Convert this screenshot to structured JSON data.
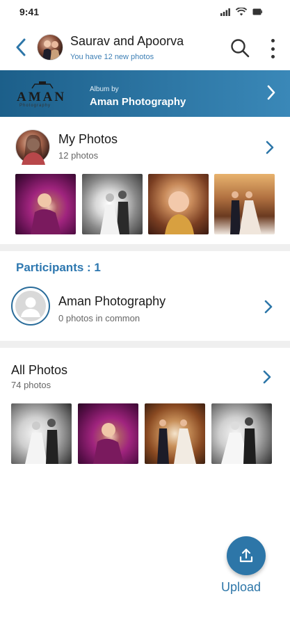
{
  "status_bar": {
    "time": "9:41"
  },
  "header": {
    "back_icon": "chevron-left-icon",
    "title": "Saurav and Apoorva",
    "subtitle": "You have 12 new photos",
    "search_icon": "search-icon",
    "more_icon": "more-vertical-icon"
  },
  "album": {
    "logo_text": "AMAN",
    "logo_sub": "Photography",
    "by_label": "Album by",
    "name": "Aman Photography"
  },
  "my_photos": {
    "title": "My Photos",
    "count": "12 photos"
  },
  "participants": {
    "title": "Participants : 1",
    "items": [
      {
        "name": "Aman Photography",
        "subtitle": "0 photos in common"
      }
    ]
  },
  "all_photos": {
    "title": "All Photos",
    "count": "74 photos"
  },
  "upload": {
    "label": "Upload",
    "icon": "upload-icon"
  },
  "colors": {
    "accent": "#2d76a8",
    "banner_start": "#1c5f8a",
    "banner_end": "#3a88b8",
    "subtitle_blue": "#3d7fb5"
  }
}
